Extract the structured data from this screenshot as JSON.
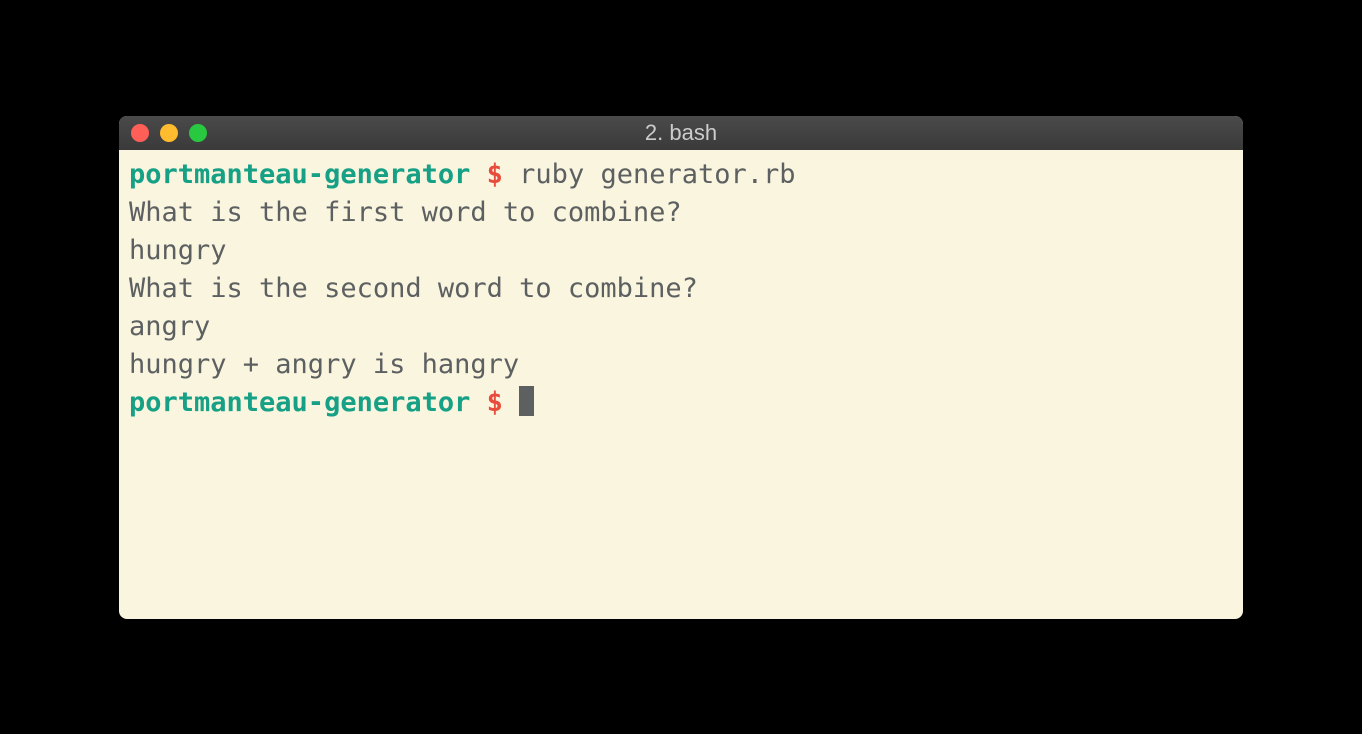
{
  "window": {
    "title": "2. bash"
  },
  "prompt": {
    "dir": "portmanteau-generator",
    "symbol": "$"
  },
  "lines": {
    "command": "ruby generator.rb",
    "out1": "What is the first word to combine?",
    "out2": "hungry",
    "out3": "What is the second word to combine?",
    "out4": "angry",
    "out5": "hungry + angry is hangry"
  }
}
